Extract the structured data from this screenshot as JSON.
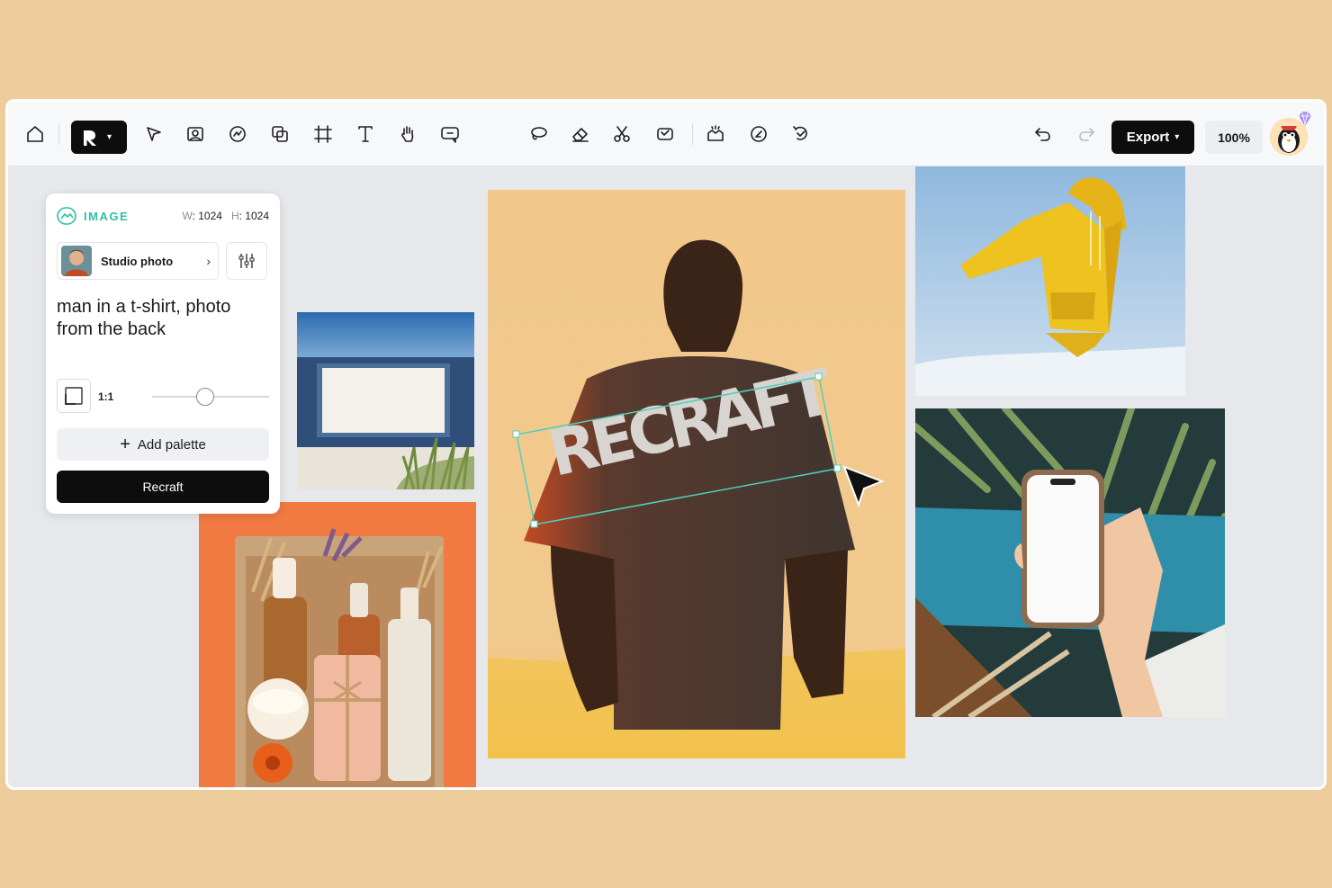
{
  "toolbar": {
    "export_label": "Export",
    "zoom_label": "100%"
  },
  "panel": {
    "tag": "IMAGE",
    "width_label": "W",
    "width_value": "1024",
    "height_label": "H",
    "height_value": "1024",
    "style_name": "Studio photo",
    "prompt": "man in a t-shirt, photo from the back",
    "ratio": "1:1",
    "slider_level": 0.45,
    "add_palette_label": "Add palette",
    "recraft_label": "Recraft"
  },
  "canvas": {
    "tshirt_text": "RECRAFT"
  },
  "colors": {
    "frame": "#eecd9c",
    "accent": "#2fbfa5",
    "dark": "#0d0d0d"
  }
}
